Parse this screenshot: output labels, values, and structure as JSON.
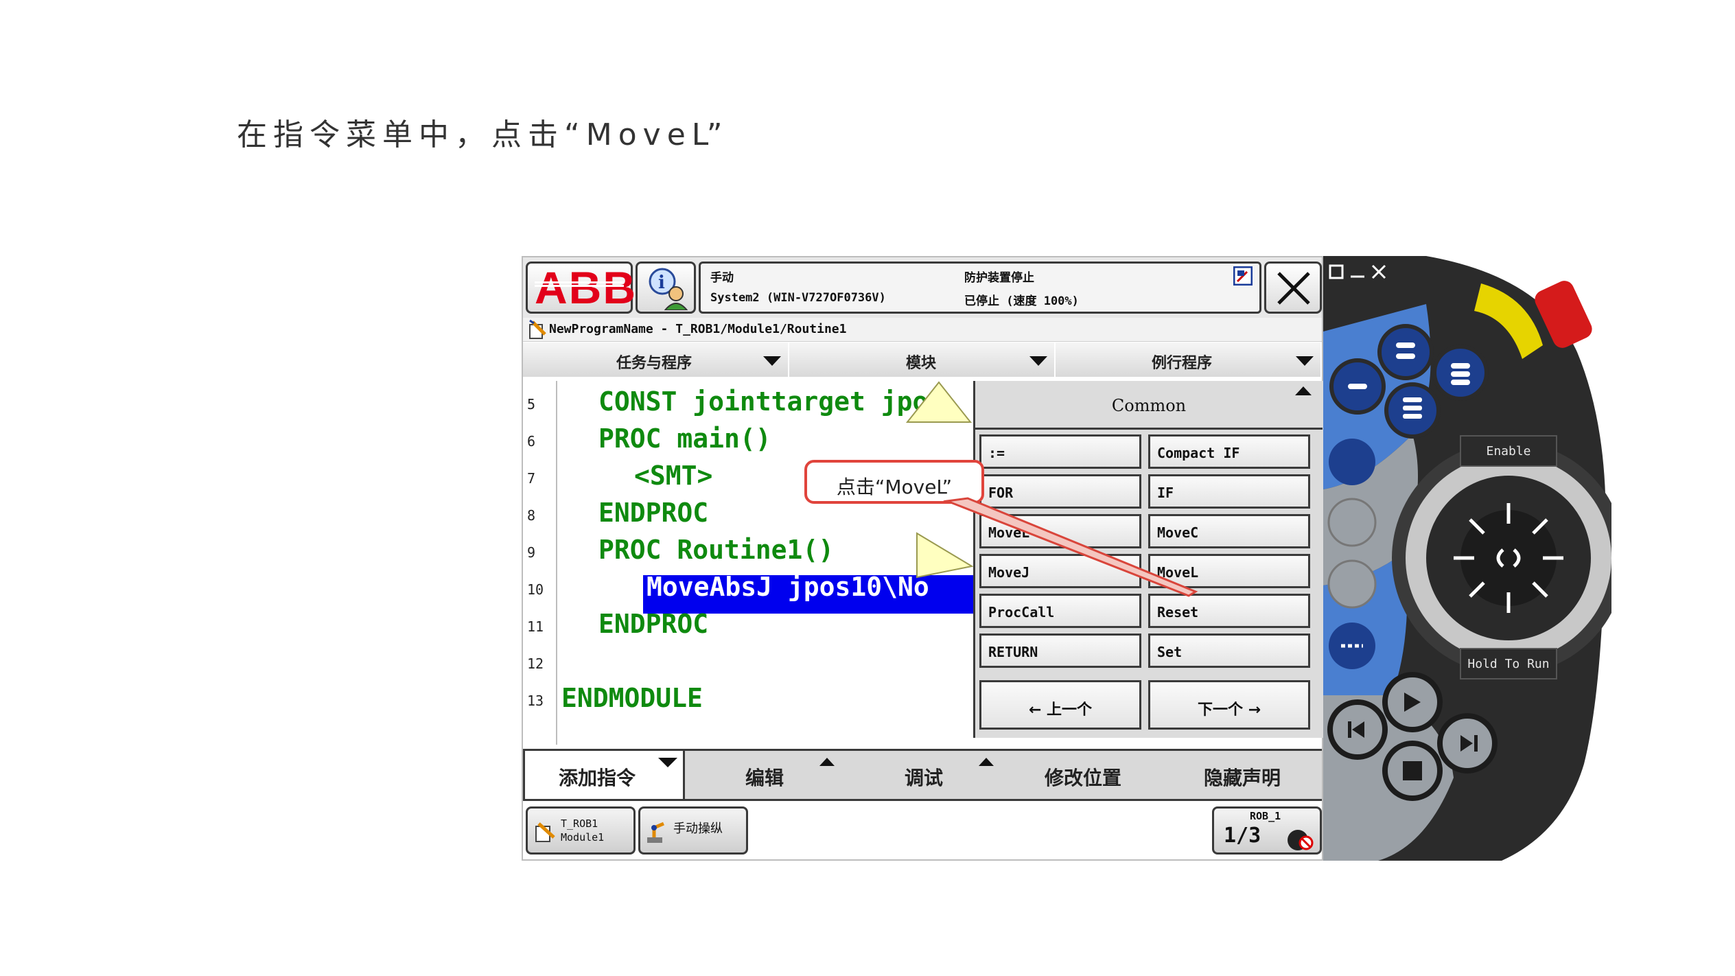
{
  "slide": {
    "title": "在指令菜单中，点击“MoveL”"
  },
  "topbar": {
    "logo": "ABB",
    "mode": "手动",
    "system": "System2 (WIN-V727OF0736V)",
    "guard_status": "防护装置停止",
    "run_status": "已停止 (速度 100%)"
  },
  "breadcrumb": {
    "text": "NewProgramName - T_ROB1/Module1/Routine1"
  },
  "columns": [
    {
      "label": "任务与程序"
    },
    {
      "label": "模块"
    },
    {
      "label": "例行程序"
    }
  ],
  "editor": {
    "lines": [
      {
        "num": "5",
        "code": "CONST jointtarget jpo"
      },
      {
        "num": "6",
        "code": "PROC main()"
      },
      {
        "num": "7",
        "code": "<SMT>"
      },
      {
        "num": "8",
        "code": "ENDPROC"
      },
      {
        "num": "9",
        "code": "PROC Routine1()"
      },
      {
        "num": "10",
        "code": "MoveAbsJ jpos10\\No"
      },
      {
        "num": "11",
        "code": "ENDPROC"
      },
      {
        "num": "12",
        "code": ""
      },
      {
        "num": "13",
        "code": "ENDMODULE"
      }
    ]
  },
  "instruction_panel": {
    "title": "Common",
    "items": [
      ":=",
      "Compact IF",
      "FOR",
      "IF",
      "MoveL",
      "MoveC",
      "MoveJ",
      "MoveL",
      "ProcCall",
      "Reset",
      "RETURN",
      "Set"
    ],
    "prev": "←  上一个",
    "next": "下一个  →"
  },
  "bottombar": {
    "add": "添加指令",
    "edit": "编辑",
    "debug": "调试",
    "modify": "修改位置",
    "hide": "隐藏声明"
  },
  "taskbar": {
    "task1_line1": "T_ROB1",
    "task1_line2": "Module1",
    "task2": "手动操纵",
    "rob": "ROB_1",
    "fraction": "1/3"
  },
  "callout": {
    "text": "点击“MoveL”"
  },
  "pendant": {
    "enable": "Enable",
    "hold": "Hold To Run"
  },
  "colors": {
    "code_green": "#0f8a0f",
    "highlight": "#0000ee",
    "callout_border": "#e0443c",
    "abb_red": "#e2001a"
  }
}
